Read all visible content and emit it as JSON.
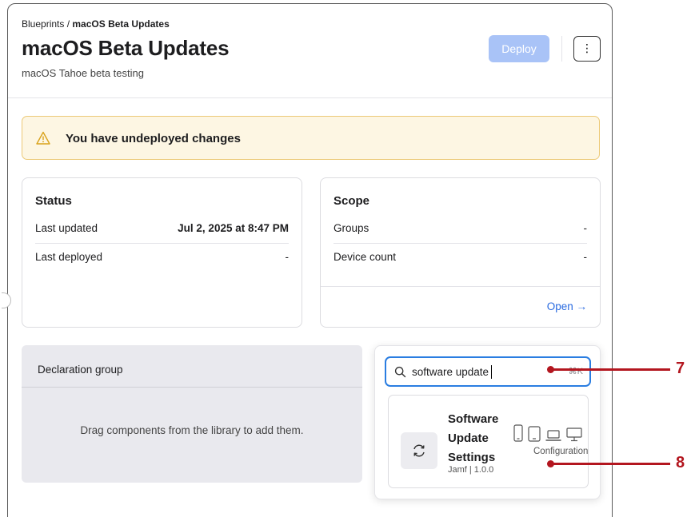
{
  "breadcrumb": {
    "root": "Blueprints",
    "separator": " / ",
    "current": "macOS Beta Updates"
  },
  "header": {
    "title": "macOS Beta Updates",
    "subtitle": "macOS Tahoe beta testing",
    "deploy_label": "Deploy",
    "more_label": "⋮"
  },
  "alert": {
    "text": "You have undeployed changes",
    "icon": "warning-triangle-icon"
  },
  "status": {
    "title": "Status",
    "rows": [
      {
        "label": "Last updated",
        "value": "Jul 2, 2025 at 8:47 PM"
      },
      {
        "label": "Last deployed",
        "value": "-"
      }
    ]
  },
  "scope": {
    "title": "Scope",
    "rows": [
      {
        "label": "Groups",
        "value": "-"
      },
      {
        "label": "Device count",
        "value": "-"
      }
    ],
    "open_label": "Open",
    "open_arrow": "→"
  },
  "declaration_group": {
    "title": "Declaration group",
    "hint": "Drag components from the library to add them."
  },
  "library_search": {
    "value": "software update",
    "shortcut": "⌘K"
  },
  "result": {
    "name": "Software Update Settings",
    "meta": "Jamf | 1.0.0",
    "type": "Configuration",
    "platforms": [
      "iphone-icon",
      "ipad-icon",
      "laptop-icon",
      "desktop-icon"
    ]
  },
  "callouts": [
    {
      "number": "7"
    },
    {
      "number": "8"
    }
  ],
  "colors": {
    "accent": "#2a7de1",
    "deploy_disabled": "#a9c3f7",
    "alert_bg": "#fdf6e3",
    "alert_border": "#ecc977",
    "callout": "#b3161f",
    "link": "#2a6be0"
  }
}
